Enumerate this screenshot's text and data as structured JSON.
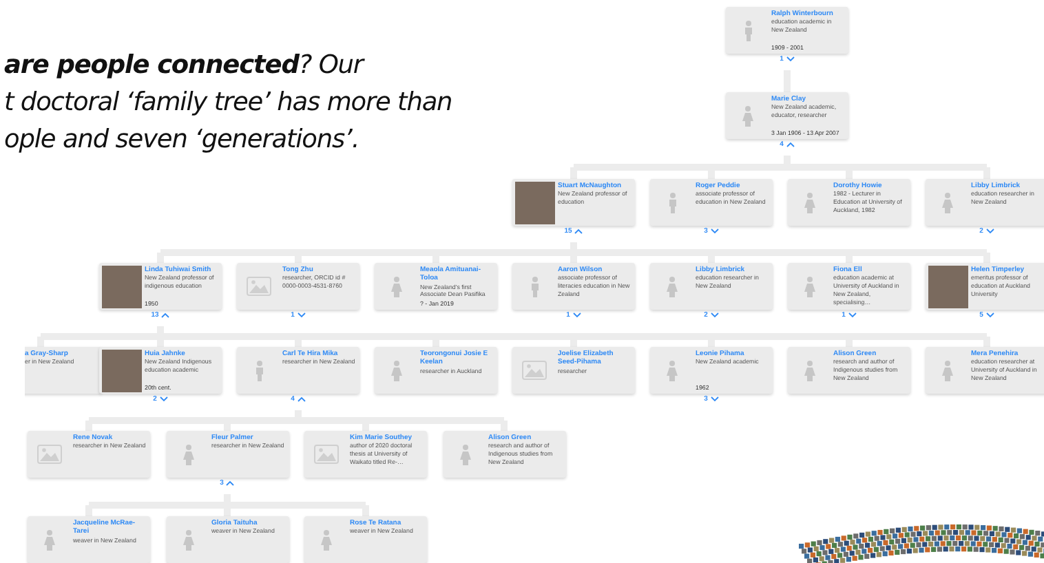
{
  "slide_text": {
    "lines": [
      "**are people connected**? Our",
      "t doctoral ‘family tree’ has more than",
      "ople and seven ‘generations’."
    ]
  },
  "tree": {
    "name": "Ralph Winterbourn",
    "description": "education academic in New Zealand",
    "dates": "1909 - 2001",
    "kind": "male",
    "count": "1",
    "expanded": false,
    "children": [
      {
        "name": "Marie Clay",
        "description": "New Zealand academic, educator, researcher",
        "dates": "3 Jan 1906 - 13 Apr 2007",
        "kind": "female",
        "count": "4",
        "expanded": true,
        "children": [
          {
            "name": "Stuart McNaughton",
            "description": "New Zealand professor of education",
            "kind": "photo",
            "count": "15",
            "expanded": true,
            "children": [
              {
                "name": "Linda Tuhiwai Smith",
                "description": "New Zealand professor of indigenous education",
                "dates": "1950",
                "kind": "photo",
                "count": "13",
                "expanded": true,
                "children": [
                  {
                    "name": "a Gray-Sharp",
                    "description": "er in New Zealand"
                  },
                  {
                    "name": "Huia Jahnke",
                    "description": "New Zealand Indigenous education academic",
                    "dates": "20th cent.",
                    "kind": "photo",
                    "count": "2",
                    "expanded": false
                  },
                  {
                    "name": "Carl Te Hira Mika",
                    "description": "researcher in New Zealand",
                    "kind": "male",
                    "count": "4",
                    "expanded": true,
                    "children": [
                      {
                        "name": "Rene Novak",
                        "description": "researcher in New Zealand",
                        "kind": "image"
                      },
                      {
                        "name": "Fleur Palmer",
                        "description": "researcher in New Zealand",
                        "kind": "female",
                        "count": "3",
                        "expanded": true,
                        "children": [
                          {
                            "name": "Jacqueline McRae-Tarei",
                            "description": "weaver in New Zealand",
                            "kind": "female"
                          },
                          {
                            "name": "Gloria Taituha",
                            "description": "weaver in New Zealand",
                            "kind": "female"
                          },
                          {
                            "name": "Rose Te Ratana",
                            "description": "weaver in New Zealand",
                            "kind": "female"
                          }
                        ]
                      },
                      {
                        "name": "Kim Marie Southey",
                        "description": "author of 2020 doctoral thesis at University of Waikato titled Re-…",
                        "kind": "image"
                      },
                      {
                        "name": "Alison Green",
                        "description": "research and author of Indigenous studies from New Zealand",
                        "kind": "female"
                      }
                    ]
                  },
                  {
                    "name": "Teorongonui Josie E Keelan",
                    "description": "researcher in Auckland",
                    "kind": "female"
                  },
                  {
                    "name": "Joelise Elizabeth Seed-Pihama",
                    "description": "researcher",
                    "kind": "image"
                  },
                  {
                    "name": "Leonie Pihama",
                    "description": "New Zealand academic",
                    "dates": "1962",
                    "kind": "female",
                    "count": "3",
                    "expanded": false
                  },
                  {
                    "name": "Alison Green",
                    "description": "research and author of Indigenous studies from New Zealand",
                    "kind": "female"
                  },
                  {
                    "name": "Mera Penehira",
                    "description": "education researcher at University of Auckland in New Zealand",
                    "kind": "female"
                  }
                ]
              },
              {
                "name": "Tong Zhu",
                "description": "researcher, ORCID id # 0000-0003-4531-8760",
                "kind": "image",
                "count": "1",
                "expanded": false
              },
              {
                "name": "Meaola Amituanai-Toloa",
                "description": "New Zealand's first Associate Dean Pasifika",
                "dates": "? - Jan 2019",
                "kind": "female"
              },
              {
                "name": "Aaron Wilson",
                "description": "associate professor of literacies education in New Zealand",
                "kind": "male",
                "count": "1",
                "expanded": false
              },
              {
                "name": "Libby Limbrick",
                "description": "education researcher in New Zealand",
                "kind": "female",
                "count": "2",
                "expanded": false
              },
              {
                "name": "Fiona Ell",
                "description": "education academic at University of Auckland in New Zealand, specialising…",
                "kind": "female",
                "count": "1",
                "expanded": false
              },
              {
                "name": "Helen Timperley",
                "description": "emeritus professor of education at Auckland University",
                "kind": "photo",
                "count": "5",
                "expanded": false
              }
            ]
          },
          {
            "name": "Roger Peddie",
            "description": "associate professor of education in New Zealand",
            "kind": "male",
            "count": "3",
            "expanded": false
          },
          {
            "name": "Dorothy Howie",
            "description": "1982 - Lecturer in Education at University of Auckland, 1982",
            "kind": "female"
          },
          {
            "name": "Libby Limbrick",
            "description": "education researcher in New Zealand",
            "kind": "female",
            "count": "2",
            "expanded": false
          }
        ]
      }
    ]
  }
}
